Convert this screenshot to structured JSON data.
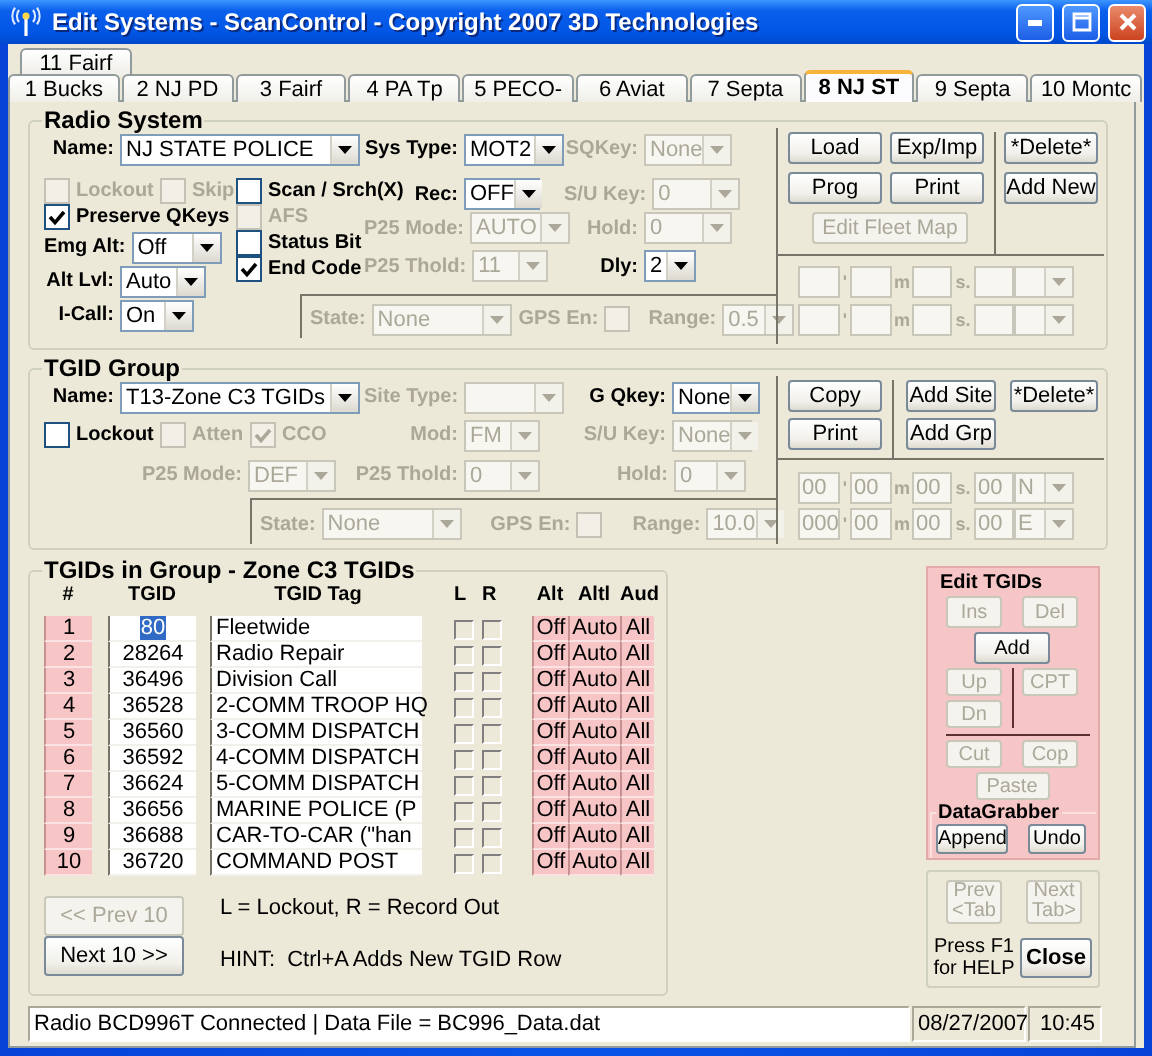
{
  "window": {
    "title": "Edit Systems - ScanControl - Copyright 2007 3D Technologies"
  },
  "tab_rows": [
    {
      "tabs": [
        {
          "label": "11 Fairf",
          "selected": false
        }
      ]
    },
    {
      "tabs": [
        {
          "label": "1 Bucks",
          "selected": false
        },
        {
          "label": "2 NJ PD",
          "selected": false
        },
        {
          "label": "3 Fairf",
          "selected": false
        },
        {
          "label": "4 PA Tp",
          "selected": false
        },
        {
          "label": "5 PECO-",
          "selected": false
        },
        {
          "label": "6 Aviat",
          "selected": false
        },
        {
          "label": "7 Septa",
          "selected": false
        },
        {
          "label": "8 NJ ST",
          "selected": true
        },
        {
          "label": "9 Septa",
          "selected": false
        },
        {
          "label": "10 Montc",
          "selected": false
        }
      ]
    }
  ],
  "radio_system": {
    "title": "Radio System",
    "fields": [
      {
        "kind": "combo",
        "label": "Name:",
        "value": "NJ STATE POLICE",
        "disabled": false
      },
      {
        "kind": "combo",
        "label": "Sys Type:",
        "value": "MOT2",
        "disabled": false
      },
      {
        "kind": "combo",
        "label": "SQKey:",
        "value": "None",
        "disabled": true
      },
      {
        "kind": "check",
        "label": "Lockout",
        "checked": false,
        "disabled": true
      },
      {
        "kind": "check",
        "label": "Skip",
        "checked": false,
        "disabled": true
      },
      {
        "kind": "check",
        "label": "Scan / Srch(X)",
        "checked": false,
        "disabled": false
      },
      {
        "kind": "combo",
        "label": "Rec:",
        "value": "OFF",
        "disabled": false
      },
      {
        "kind": "combo",
        "label": "S/U Key:",
        "value": "0",
        "disabled": true
      },
      {
        "kind": "check",
        "label": "Preserve QKeys",
        "checked": true,
        "disabled": false
      },
      {
        "kind": "check",
        "label": "AFS",
        "checked": false,
        "disabled": true
      },
      {
        "kind": "combo",
        "label": "P25 Mode:",
        "value": "AUTO",
        "disabled": true
      },
      {
        "kind": "combo",
        "label": "Hold:",
        "value": "0",
        "disabled": true
      },
      {
        "kind": "combo",
        "label": "Emg Alt:",
        "value": "Off",
        "disabled": false
      },
      {
        "kind": "check",
        "label": "Status Bit",
        "checked": false,
        "disabled": false
      },
      {
        "kind": "check",
        "label": "End Code",
        "checked": true,
        "disabled": false
      },
      {
        "kind": "combo",
        "label": "P25 Thold:",
        "value": "11",
        "disabled": true
      },
      {
        "kind": "combo",
        "label": "Dly:",
        "value": "2",
        "disabled": false
      },
      {
        "kind": "combo",
        "label": "Alt Lvl:",
        "value": "Auto",
        "disabled": false
      },
      {
        "kind": "combo",
        "label": "I-Call:",
        "value": "On",
        "disabled": false
      }
    ],
    "location": [
      {
        "kind": "combo",
        "label": "State:",
        "value": "None",
        "disabled": true
      },
      {
        "kind": "label_check",
        "label": "GPS En:",
        "checked": false,
        "disabled": true
      },
      {
        "kind": "combo",
        "label": "Range:",
        "value": "0.5",
        "disabled": true
      }
    ],
    "buttons": [
      {
        "label": "Load",
        "disabled": false
      },
      {
        "label": "Exp/Imp",
        "disabled": false
      },
      {
        "label": "*Delete*",
        "disabled": false
      },
      {
        "label": "Prog",
        "disabled": false
      },
      {
        "label": "Print",
        "disabled": false
      },
      {
        "label": "Add New",
        "disabled": false
      },
      {
        "label": "Edit Fleet Map",
        "disabled": true
      }
    ],
    "coordinates": [
      {
        "marks": [
          "'",
          "m",
          "s."
        ]
      },
      {
        "marks": [
          "'",
          "m",
          "s."
        ]
      }
    ]
  },
  "tgid_group": {
    "title": "TGID Group",
    "fields": [
      {
        "kind": "combo",
        "label": "Name:",
        "value": "T13-Zone C3 TGIDs",
        "disabled": false
      },
      {
        "kind": "combo",
        "label": "Site Type:",
        "disabled": true
      },
      {
        "kind": "combo",
        "label": "G Qkey:",
        "value": "None",
        "disabled": false
      },
      {
        "kind": "check",
        "label": "Lockout",
        "checked": false,
        "disabled": false
      },
      {
        "kind": "check",
        "label": "Atten",
        "checked": false,
        "disabled": true
      },
      {
        "kind": "check",
        "label": "CCO",
        "checked": true,
        "disabled": true
      },
      {
        "kind": "combo",
        "label": "Mod:",
        "value": "FM",
        "disabled": true
      },
      {
        "kind": "combo",
        "label": "S/U Key:",
        "value": "None",
        "disabled": true
      },
      {
        "kind": "combo",
        "label": "P25 Mode:",
        "value": "DEF",
        "disabled": true
      },
      {
        "kind": "combo",
        "label": "P25 Thold:",
        "value": "0",
        "disabled": true
      },
      {
        "kind": "combo",
        "label": "Hold:",
        "value": "0",
        "disabled": true
      }
    ],
    "location": [
      {
        "kind": "combo",
        "label": "State:",
        "value": "None",
        "disabled": true
      },
      {
        "kind": "label_check",
        "label": "GPS En:",
        "checked": false,
        "disabled": true
      },
      {
        "kind": "combo",
        "label": "Range:",
        "value": "10.0",
        "disabled": true
      }
    ],
    "buttons": [
      {
        "label": "Copy",
        "disabled": false
      },
      {
        "label": "Add Site",
        "disabled": false
      },
      {
        "label": "*Delete*",
        "disabled": false
      },
      {
        "label": "Print",
        "disabled": false
      },
      {
        "label": "Add Grp",
        "disabled": false
      }
    ],
    "coordinates": [
      {
        "values": [
          "00",
          "00",
          "00",
          "00"
        ],
        "marks": [
          "'",
          "m",
          "s."
        ],
        "direction": "N"
      },
      {
        "values": [
          "000",
          "00",
          "00",
          "00"
        ],
        "marks": [
          "'",
          "m",
          "s."
        ],
        "direction": "E"
      }
    ]
  },
  "tgid_list": {
    "title": "TGIDs in Group - Zone C3 TGIDs",
    "columns": [
      "#",
      "TGID",
      "TGID Tag",
      "L",
      "R",
      "Alt",
      "Altl",
      "Aud"
    ],
    "rows": [
      {
        "number": "1",
        "tgid": "80",
        "tag": "Fleetwide",
        "lockout": false,
        "record_out": false,
        "alt": "Off",
        "altl": "Auto",
        "aud": "All",
        "selected": true
      },
      {
        "number": "2",
        "tgid": "28264",
        "tag": "Radio Repair",
        "lockout": false,
        "record_out": false,
        "alt": "Off",
        "altl": "Auto",
        "aud": "All",
        "selected": false
      },
      {
        "number": "3",
        "tgid": "36496",
        "tag": "Division Call",
        "lockout": false,
        "record_out": false,
        "alt": "Off",
        "altl": "Auto",
        "aud": "All",
        "selected": false
      },
      {
        "number": "4",
        "tgid": "36528",
        "tag": "2-COMM TROOP HQ",
        "lockout": false,
        "record_out": false,
        "alt": "Off",
        "altl": "Auto",
        "aud": "All",
        "selected": false
      },
      {
        "number": "5",
        "tgid": "36560",
        "tag": "3-COMM DISPATCH",
        "lockout": false,
        "record_out": false,
        "alt": "Off",
        "altl": "Auto",
        "aud": "All",
        "selected": false
      },
      {
        "number": "6",
        "tgid": "36592",
        "tag": "4-COMM DISPATCH",
        "lockout": false,
        "record_out": false,
        "alt": "Off",
        "altl": "Auto",
        "aud": "All",
        "selected": false
      },
      {
        "number": "7",
        "tgid": "36624",
        "tag": "5-COMM DISPATCH",
        "lockout": false,
        "record_out": false,
        "alt": "Off",
        "altl": "Auto",
        "aud": "All",
        "selected": false
      },
      {
        "number": "8",
        "tgid": "36656",
        "tag": "MARINE POLICE (P",
        "lockout": false,
        "record_out": false,
        "alt": "Off",
        "altl": "Auto",
        "aud": "All",
        "selected": false
      },
      {
        "number": "9",
        "tgid": "36688",
        "tag": "CAR-TO-CAR (\"han",
        "lockout": false,
        "record_out": false,
        "alt": "Off",
        "altl": "Auto",
        "aud": "All",
        "selected": false
      },
      {
        "number": "10",
        "tgid": "36720",
        "tag": "COMMAND POST",
        "lockout": false,
        "record_out": false,
        "alt": "Off",
        "altl": "Auto",
        "aud": "All",
        "selected": false
      }
    ],
    "prev_button": {
      "label": "<< Prev 10",
      "disabled": true
    },
    "next_button": {
      "label": "Next 10 >>",
      "disabled": false
    },
    "legend": "L = Lockout, R = Record Out",
    "hint": "HINT:  Ctrl+A Adds New TGID Row"
  },
  "edit_tgids": {
    "title": "Edit TGIDs",
    "buttons": [
      {
        "label": "Ins",
        "disabled": true
      },
      {
        "label": "Del",
        "disabled": true
      },
      {
        "label": "Add",
        "disabled": false
      },
      {
        "label": "Up",
        "disabled": true
      },
      {
        "label": "Dn",
        "disabled": true
      },
      {
        "label": "CPT",
        "disabled": true
      },
      {
        "label": "Cut",
        "disabled": true
      },
      {
        "label": "Cop",
        "disabled": true
      },
      {
        "label": "Paste",
        "disabled": true
      }
    ],
    "data_grabber": {
      "title": "DataGrabber",
      "buttons": [
        {
          "label": "Append",
          "disabled": false
        },
        {
          "label": "Undo",
          "disabled": false
        }
      ]
    }
  },
  "navigation": {
    "buttons": [
      {
        "label": "Prev\n<Tab",
        "disabled": true
      },
      {
        "label": "Next\nTab>",
        "disabled": true
      }
    ],
    "help": "Press F1\nfor HELP",
    "close": "Close"
  },
  "status_bar": {
    "message": "Radio BCD996T Connected | Data File = BC996_Data.dat",
    "date": "08/27/2007",
    "time": "10:45"
  }
}
